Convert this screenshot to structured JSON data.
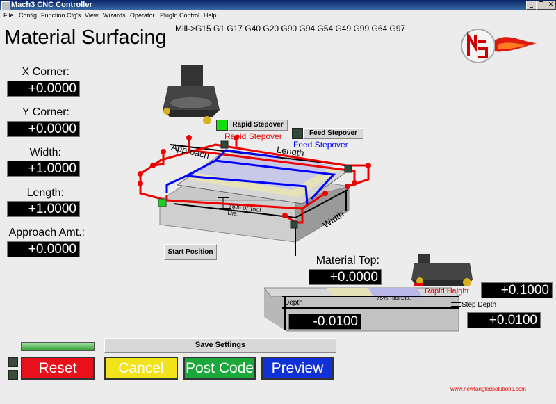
{
  "window": {
    "title": "Mach3 CNC Controller"
  },
  "menu": [
    "File",
    "Config",
    "Function Cfg's",
    "View",
    "Wizards",
    "Operator",
    "PlugIn Control",
    "Help"
  ],
  "gcode_line": "Mill->G15  G1 G17 G40 G20 G90 G94 G54 G49 G99 G64 G97",
  "page_title": "Material Surfacing",
  "fields": {
    "x_corner": {
      "label": "X Corner:",
      "value": "+0.0000"
    },
    "y_corner": {
      "label": "Y Corner:",
      "value": "+0.0000"
    },
    "width": {
      "label": "Width:",
      "value": "+1.0000"
    },
    "length": {
      "label": "Length:",
      "value": "+1.0000"
    },
    "approach": {
      "label": "Approach Amt.:",
      "value": "+0.0000"
    },
    "material_top": {
      "label": "Material Top:",
      "value": "+0.0000"
    },
    "rapid_height": {
      "value": "+0.1000"
    },
    "depth": {
      "value": "-0.0100"
    },
    "step_depth": {
      "value": "+0.0100"
    }
  },
  "diagram": {
    "rapid_stepover_button": "Rapid Stepover",
    "feed_stepover_button": "Feed Stepover",
    "rapid_stepover_text": "Rapid Stepover",
    "feed_stepover_text": "Feed Stepover",
    "approach": "Approach",
    "length": "Length",
    "width": "Width",
    "tool_dia": "75% of Tool Dia.",
    "start_position": "Start Position",
    "depth_label": "Depth",
    "step_depth_label": "Step Depth",
    "rapid_height_label": "Rapid Height",
    "tool_dia_small": "75% Tool Dia."
  },
  "buttons": {
    "save": "Save Settings",
    "reset": "Reset",
    "cancel": "Cancel",
    "post": "Post Code",
    "preview": "Preview"
  },
  "website": "www.newfangledsolutions.com",
  "colors": {
    "reset": "#e8101a",
    "cancel": "#f2e21a",
    "post": "#1aa83a",
    "preview": "#1030d8"
  }
}
